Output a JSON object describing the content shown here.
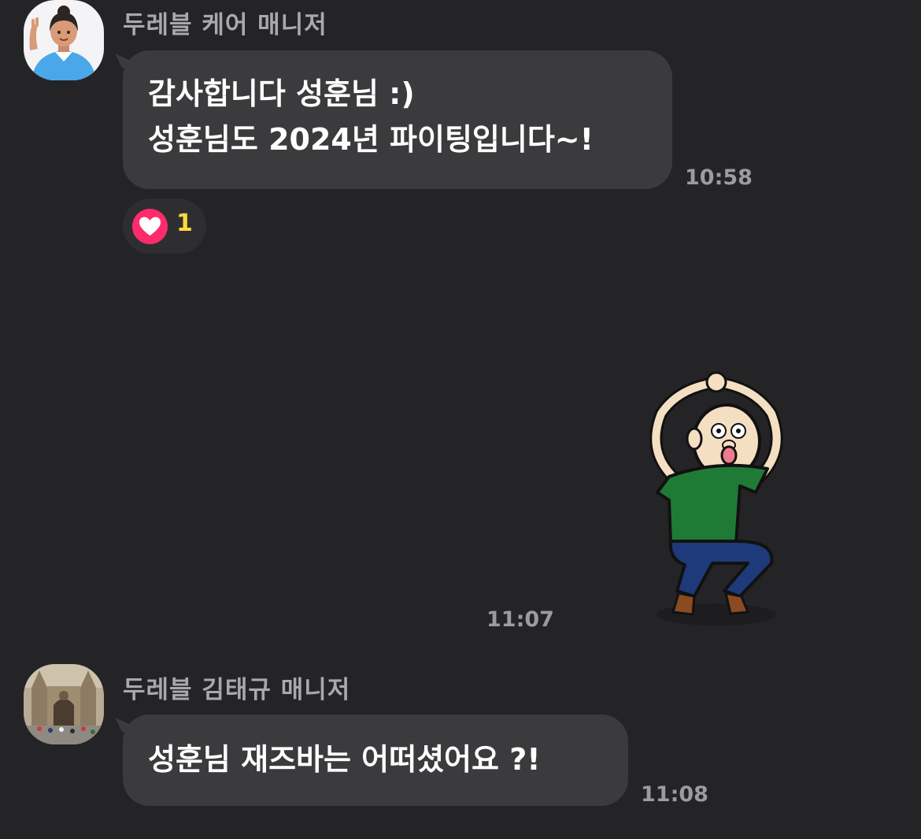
{
  "messages": [
    {
      "sender": "두레블 케어 매니저",
      "avatar_icon": "woman-avatar-icon",
      "lines": [
        "감사합니다 성훈님 :)",
        "성훈님도 2024년 파이팅입니다~!"
      ],
      "time": "10:58",
      "reaction": {
        "icon": "heart-icon",
        "count": "1",
        "color": "#ff2b6b"
      }
    },
    {
      "type": "sticker",
      "sticker_icon": "dancing-man-sticker-icon",
      "time": "11:07"
    },
    {
      "sender": "두레블 김태규 매니저",
      "avatar_icon": "cathedral-photo-avatar-icon",
      "lines": [
        "성훈님 재즈바는 어떠셨어요 ?!"
      ],
      "time": "11:08"
    }
  ],
  "colors": {
    "background": "#242427",
    "bubble": "#3b3b3e",
    "reaction_count": "#ffd83a"
  }
}
